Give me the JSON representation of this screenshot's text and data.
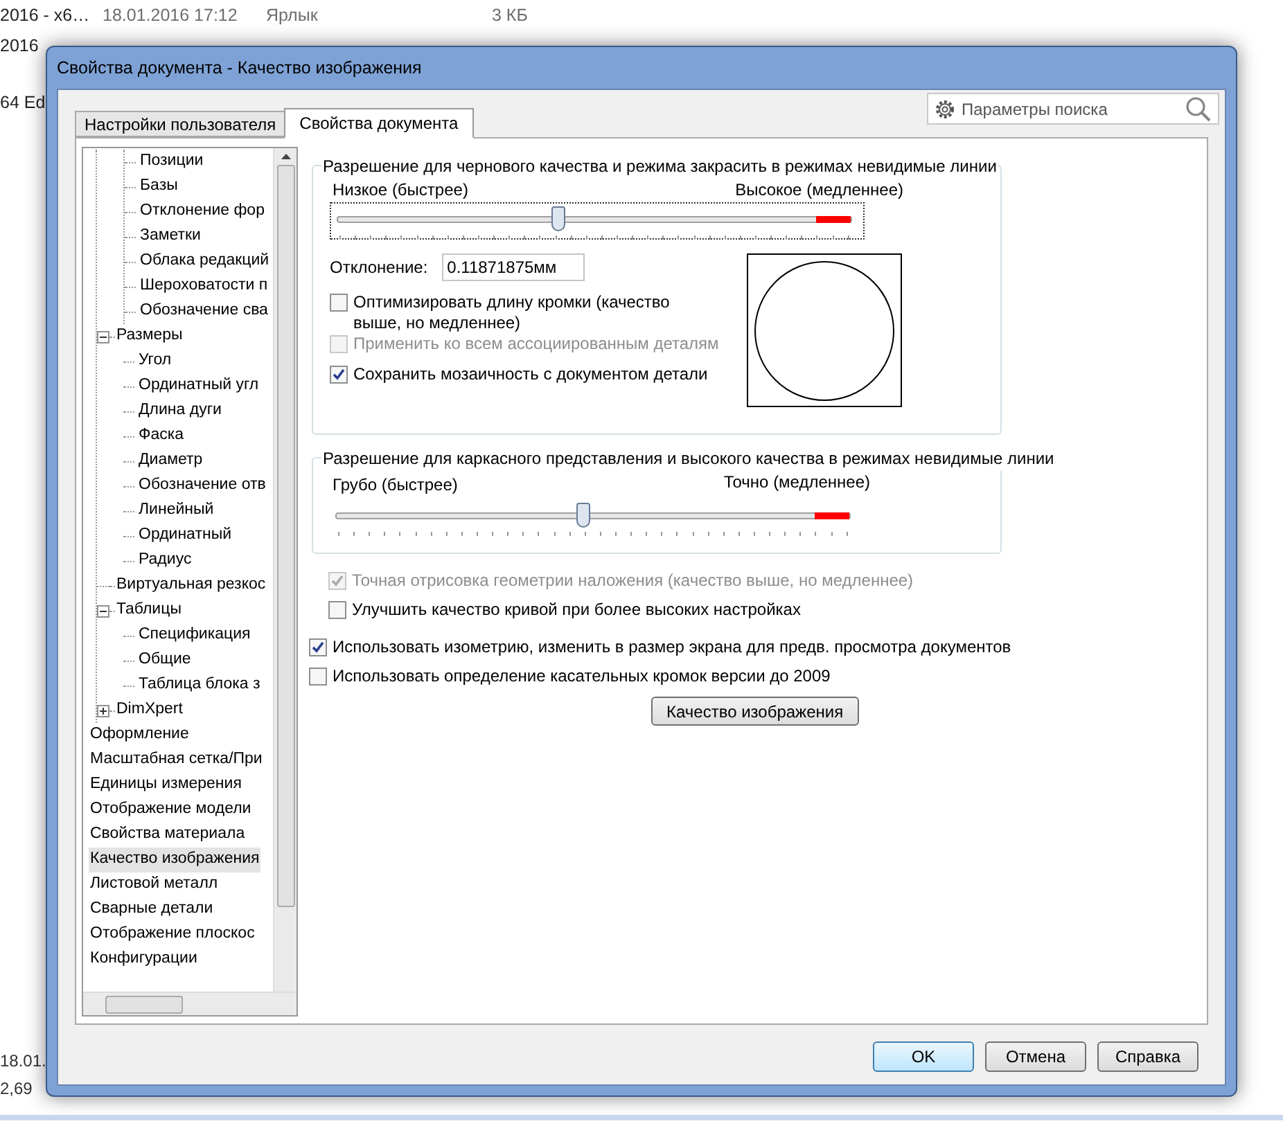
{
  "background_list": {
    "rows": [
      {
        "name": "2016 - x6…",
        "date": "18.01.2016 17:12",
        "type": "Ярлык",
        "size": "3 КБ"
      },
      {
        "name": "2016"
      },
      {
        "name": "64 Ed"
      }
    ],
    "footer": [
      "18.01.",
      "2,69"
    ]
  },
  "window": {
    "title": "Свойства документа - Качество изображения"
  },
  "tabs": [
    {
      "label": "Настройки пользователя",
      "selected": false
    },
    {
      "label": "Свойства документа",
      "selected": true
    }
  ],
  "search": {
    "placeholder": "Параметры поиска"
  },
  "tree": {
    "items": [
      {
        "expanded": true,
        "children": [
          {
            "expanded": true,
            "children": [
              {
                "label": "Позиции"
              },
              {
                "label": "Базы"
              },
              {
                "label": "Отклонение фор"
              },
              {
                "label": "Заметки"
              },
              {
                "label": "Облака редакций"
              },
              {
                "label": "Шероховатости п"
              },
              {
                "label": "Обозначение сва"
              }
            ]
          },
          {
            "label": "Размеры",
            "expanded": true,
            "children": [
              {
                "label": "Угол"
              },
              {
                "label": "Ординатный угл"
              },
              {
                "label": "Длина дуги"
              },
              {
                "label": "Фаска"
              },
              {
                "label": "Диаметр"
              },
              {
                "label": "Обозначение отв"
              },
              {
                "label": "Линейный"
              },
              {
                "label": "Ординатный"
              },
              {
                "label": "Радиус"
              }
            ]
          },
          {
            "label": "Виртуальная резкос"
          },
          {
            "label": "Таблицы",
            "expanded": true,
            "children": [
              {
                "label": "Спецификация"
              },
              {
                "label": "Общие"
              },
              {
                "label": "Таблица блока з"
              }
            ]
          },
          {
            "label": "DimXpert",
            "expanded": false
          }
        ]
      },
      {
        "label": "Оформление",
        "selected": false
      },
      {
        "label": "Масштабная сетка/При",
        "selected": false
      },
      {
        "label": "Единицы измерения",
        "selected": false
      },
      {
        "label": "Отображение модели",
        "selected": false
      },
      {
        "label": "Свойства материала",
        "selected": false
      },
      {
        "label": "Качество изображения",
        "selected": true
      },
      {
        "label": "Листовой металл",
        "selected": false
      },
      {
        "label": "Сварные детали",
        "selected": false
      },
      {
        "label": "Отображение плоскос",
        "selected": false
      },
      {
        "label": "Конфигурации",
        "selected": false
      }
    ]
  },
  "shaded_group": {
    "title": "Разрешение для чернового качества и режима закрасить в режимах невидимые линии",
    "low_label": "Низкое (быстрее)",
    "high_label": "Высокое (медленнее)",
    "level": 0.43,
    "deviation": {
      "label": "Отклонение:",
      "value": "0.11871875мм"
    },
    "options": [
      {
        "label": "Оптимизировать длину кромки (качество выше, но медленнее)",
        "checked": false,
        "disabled": false
      },
      {
        "label": "Применить ко всем ассоциированным деталям",
        "checked": false,
        "disabled": true
      },
      {
        "label": "Сохранить мозаичность с документом детали",
        "checked": true,
        "disabled": false
      }
    ]
  },
  "wireframe_group": {
    "title": "Разрешение для каркасного представления и высокого качества в режимах невидимые линии",
    "low_label": "Грубо (быстрее)",
    "high_label": "Точно (медленнее)",
    "level": 0.48,
    "options": [
      {
        "label": "Точная отрисовка геометрии наложения (качество выше, но медленнее)",
        "checked": true,
        "disabled": true
      },
      {
        "label": "Улучшить качество кривой при более высоких настройках",
        "checked": false,
        "disabled": false
      }
    ]
  },
  "options": [
    {
      "label": "Использовать изометрию, изменить в размер экрана для предв. просмотра документов",
      "checked": true,
      "disabled": false
    },
    {
      "label": "Использовать определение касательных кромок версии до 2009",
      "checked": false,
      "disabled": false
    }
  ],
  "image_quality_button": "Качество изображения",
  "buttons": [
    {
      "label": "OK",
      "default": true
    },
    {
      "label": "Отмена",
      "default": false
    },
    {
      "label": "Справка",
      "default": false
    }
  ]
}
